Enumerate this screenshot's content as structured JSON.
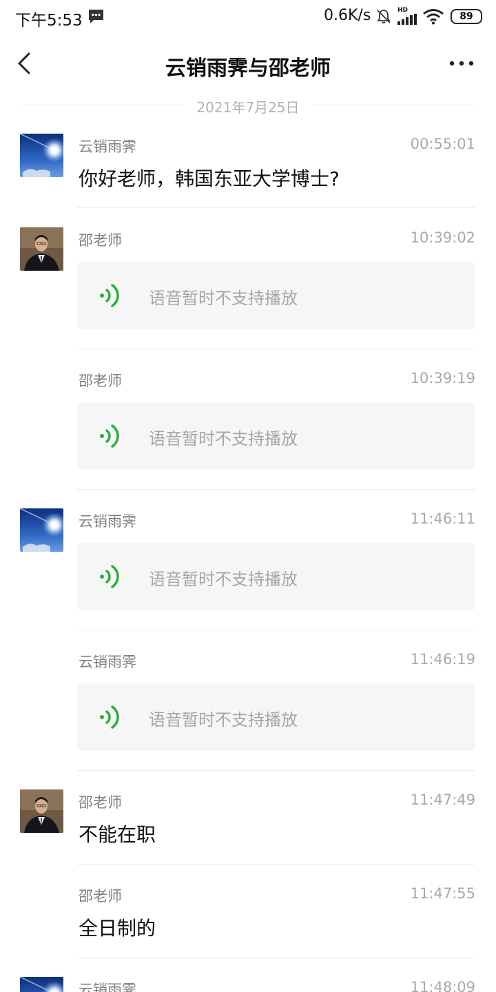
{
  "status_bar": {
    "time": "下午5:53",
    "net_speed": "0.6K/s",
    "hd": "HD",
    "battery": "89"
  },
  "header": {
    "title": "云销雨霁与邵老师"
  },
  "date_divider": "2021年7月25日",
  "messages": [
    {
      "sender": "云销雨霁",
      "time": "00:55:01",
      "text": "你好老师，韩国东亚大学博士?",
      "avatar": "sun-sky-avatar"
    },
    {
      "sender": "邵老师",
      "time": "10:39:02",
      "voice": "语音暂时不支持播放",
      "avatar": "man-in-suit-avatar"
    },
    {
      "sender": "邵老师",
      "time": "10:39:19",
      "voice": "语音暂时不支持播放"
    },
    {
      "sender": "云销雨霁",
      "time": "11:46:11",
      "voice": "语音暂时不支持播放",
      "avatar": "sun-sky-avatar"
    },
    {
      "sender": "云销雨霁",
      "time": "11:46:19",
      "voice": "语音暂时不支持播放"
    },
    {
      "sender": "邵老师",
      "time": "11:47:49",
      "text": "不能在职",
      "avatar": "man-in-suit-avatar"
    },
    {
      "sender": "邵老师",
      "time": "11:47:55",
      "text": "全日制的"
    },
    {
      "sender": "云销雨霁",
      "time": "11:48:09",
      "avatar": "sun-sky-avatar"
    }
  ],
  "colors": {
    "voice_icon": "#2aae3b",
    "bubble_bg": "#f6f6f6",
    "meta_text": "#a8a8a8"
  }
}
